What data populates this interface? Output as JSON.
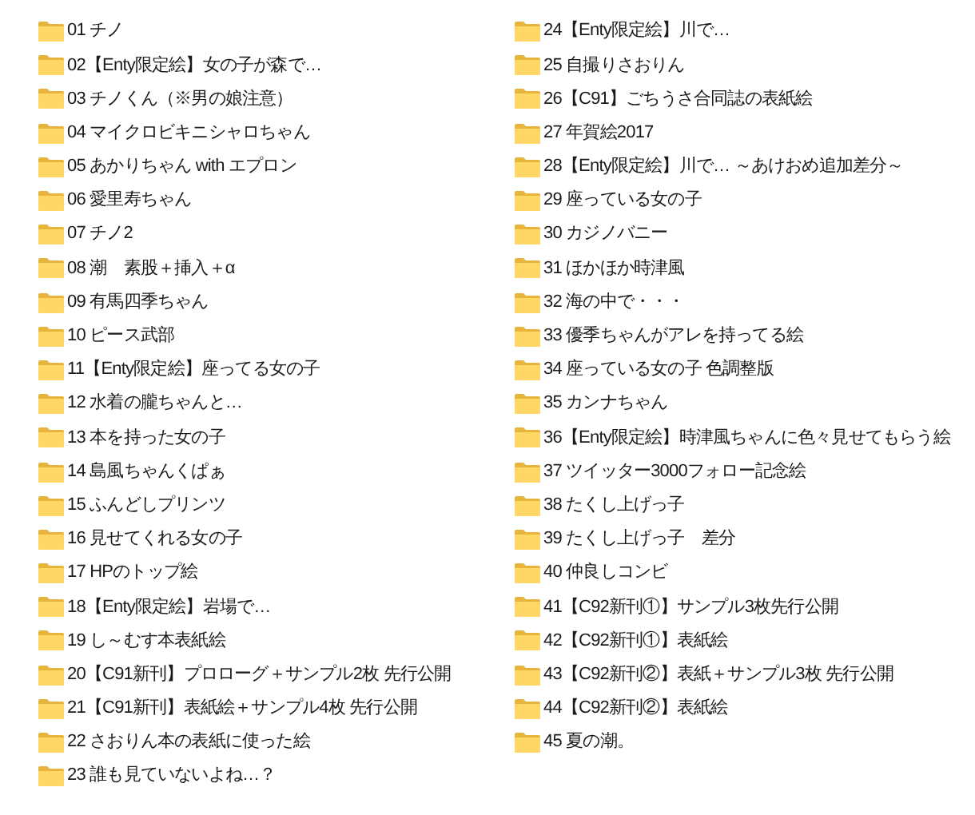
{
  "columns": [
    {
      "folders": [
        "01 チノ",
        "02【Enty限定絵】女の子が森で…",
        "03 チノくん（※男の娘注意）",
        "04 マイクロビキニシャロちゃん",
        "05 あかりちゃん with エプロン",
        "06 愛里寿ちゃん",
        "07 チノ2",
        "08 潮　素股＋挿入＋α",
        "09 有馬四季ちゃん",
        "10 ピース武部",
        "11【Enty限定絵】座ってる女の子",
        "12 水着の朧ちゃんと…",
        "13 本を持った女の子",
        "14 島風ちゃんくぱぁ",
        "15 ふんどしプリンツ",
        "16 見せてくれる女の子",
        "17 HPのトップ絵",
        "18【Enty限定絵】岩場で…",
        "19 し～むす本表紙絵",
        "20【C91新刊】プロローグ＋サンプル2枚 先行公開",
        "21【C91新刊】表紙絵＋サンプル4枚 先行公開",
        "22 さおりん本の表紙に使った絵",
        "23 誰も見ていないよね…？"
      ]
    },
    {
      "folders": [
        "24【Enty限定絵】川で…",
        "25 自撮りさおりん",
        "26【C91】ごちうさ合同誌の表紙絵",
        "27 年賀絵2017",
        "28【Enty限定絵】川で… ～あけおめ追加差分～",
        "29 座っている女の子",
        "30 カジノバニー",
        "31 ほかほか時津風",
        "32 海の中で・・・",
        "33 優季ちゃんがアレを持ってる絵",
        "34 座っている女の子 色調整版",
        "35 カンナちゃん",
        "36【Enty限定絵】時津風ちゃんに色々見せてもらう絵",
        "37 ツイッター3000フォロー記念絵",
        "38 たくし上げっ子",
        "39 たくし上げっ子　差分",
        "40 仲良しコンビ",
        "41【C92新刊①】サンプル3枚先行公開",
        "42【C92新刊①】表紙絵",
        "43【C92新刊②】表紙＋サンプル3枚 先行公開",
        "44【C92新刊②】表紙絵",
        "45 夏の潮。"
      ]
    }
  ]
}
